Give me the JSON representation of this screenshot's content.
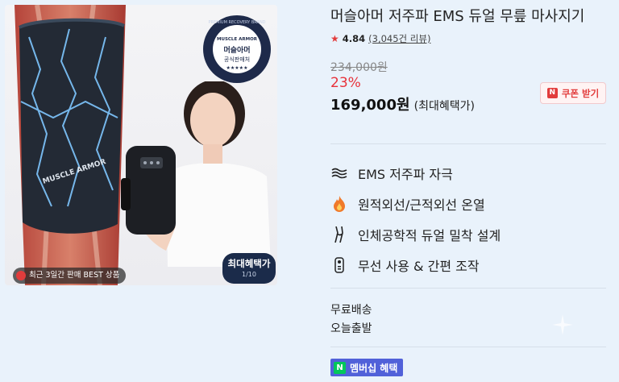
{
  "product": {
    "title": "머슬아머 저주파 EMS 듀얼 무릎 마사지기",
    "rating": "4.84",
    "review_count": "(3,045건 리뷰)",
    "original_price": "234,000원",
    "discount_rate": "23%",
    "final_price": "169,000원",
    "final_price_note": "(최대혜택가)"
  },
  "coupon": {
    "label": "쿠폰 받기",
    "icon_letter": "N"
  },
  "gallery": {
    "best_label": "최근 3일간 판매 BEST 상품",
    "benefit_label": "최대혜택가",
    "image_counter": "1/10",
    "seal": {
      "brand": "MUSCLE ARMOR",
      "line1": "머슬아머",
      "line2": "공식판매처",
      "ring_text": "PREMIUM RECOVERY BRAND"
    },
    "sleeve_brand": "MUSCLE ARMOR"
  },
  "features": [
    {
      "icon": "wave-icon",
      "label": "EMS 저주파 자극"
    },
    {
      "icon": "flame-icon",
      "label": "원적외선/근적외선 온열"
    },
    {
      "icon": "knee-icon",
      "label": "인체공학적 듀얼 밀착 설계"
    },
    {
      "icon": "remote-icon",
      "label": "무선 사용 & 간편 조작"
    }
  ],
  "shipping": {
    "line1": "무료배송",
    "line2": "오늘출발"
  },
  "membership": {
    "icon_letter": "N",
    "label": "멤버십 혜택"
  },
  "colors": {
    "discount": "#e8313a",
    "coupon_bg": "#fff3f3",
    "membership_bg": "#5161d9",
    "page_bg": "#e9f2fb"
  }
}
